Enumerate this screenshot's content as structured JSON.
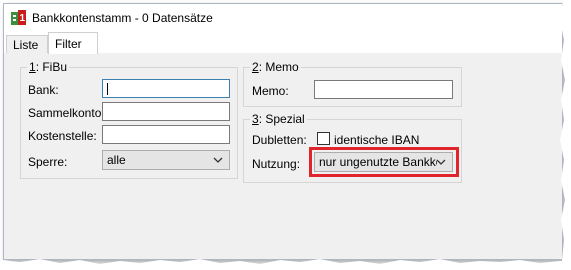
{
  "window": {
    "title": "Bankkontenstamm - 0 Datensätze",
    "icon": "bank-ledger-icon"
  },
  "tabs": [
    {
      "label": "Liste"
    },
    {
      "label": "Filter"
    }
  ],
  "fibu": {
    "legend_key": "1",
    "legend_rest": ": FiBu",
    "bank_label": "Bank:",
    "bank_value": "",
    "sammelkonto_label": "Sammelkonto:",
    "sammelkonto_value": "",
    "kostenstelle_label": "Kostenstelle:",
    "kostenstelle_value": "",
    "sperre_label": "Sperre:",
    "sperre_value": "alle"
  },
  "memo": {
    "legend_key": "2",
    "legend_rest": ": Memo",
    "memo_label": "Memo:",
    "memo_value": ""
  },
  "spezial": {
    "legend_key": "3",
    "legend_rest": ": Spezial",
    "dubletten_label": "Dubletten:",
    "identische_iban_label": "identische IBAN",
    "identische_iban_checked": false,
    "nutzung_label": "Nutzung:",
    "nutzung_value": "nur ungenutzte Bankkoı"
  },
  "colors": {
    "highlight": "#e0262a",
    "focus_border": "#3c7fb1",
    "panel_bg": "#f0f0f0"
  }
}
